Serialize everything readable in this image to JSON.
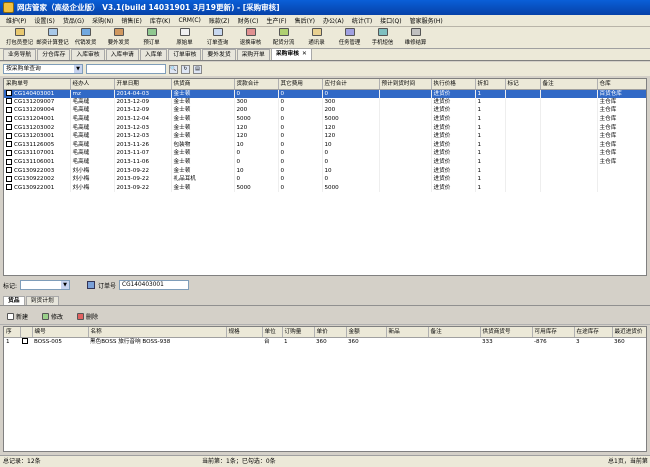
{
  "window": {
    "title": "网店管家（高级企业版） V3.1(build 14031901 3月19更新) - [采购审核]"
  },
  "menu": [
    "维护(P)",
    "设置(S)",
    "货品(G)",
    "采购(N)",
    "销售(E)",
    "库存(K)",
    "CRM(C)",
    "账款(Z)",
    "财务(C)",
    "生产(F)",
    "售后(Y)",
    "办公(A)",
    "统计(T)",
    "接口(Q)",
    "管家服务(H)"
  ],
  "toolbar": [
    {
      "label": "打包员登记",
      "icon": "package-icon"
    },
    {
      "label": "邮资计算登记",
      "icon": "calculator-icon"
    },
    {
      "label": "代销发货",
      "icon": "truck-icon"
    },
    {
      "label": "要外发货",
      "icon": "box-icon"
    },
    {
      "label": "预订单",
      "icon": "clipboard-icon"
    },
    {
      "label": "原始单",
      "icon": "document-icon"
    },
    {
      "label": "订单查询",
      "icon": "search-icon"
    },
    {
      "label": "退换审核",
      "icon": "return-icon"
    },
    {
      "label": "配货分流",
      "icon": "split-icon"
    },
    {
      "label": "通讯录",
      "icon": "contacts-icon"
    },
    {
      "label": "任务管理",
      "icon": "task-icon"
    },
    {
      "label": "手机短信",
      "icon": "phone-icon"
    },
    {
      "label": "维修结算",
      "icon": "wrench-icon"
    }
  ],
  "tabs": [
    {
      "label": "业务导航",
      "active": false
    },
    {
      "label": "分仓库存",
      "active": false
    },
    {
      "label": "入库审核",
      "active": false
    },
    {
      "label": "入库申请",
      "active": false
    },
    {
      "label": "入库单",
      "active": false
    },
    {
      "label": "订单审核",
      "active": false
    },
    {
      "label": "要外发货",
      "active": false
    },
    {
      "label": "采购开单",
      "active": false
    },
    {
      "label": "采购审核",
      "active": true
    }
  ],
  "query": {
    "mode": "按采购单查询",
    "value": ""
  },
  "purchase_table": {
    "columns": [
      "采购单号",
      "经办人",
      "开单日期",
      "供货商",
      "货款合计",
      "其它费用",
      "应付合计",
      "预计到货时间",
      "执行价格",
      "折扣",
      "标记",
      "备注",
      "仓库"
    ],
    "rows": [
      [
        "CG140403001",
        "mz",
        "2014-04-03",
        "金士顿",
        "0",
        "0",
        "0",
        "",
        "进货价",
        "1",
        "",
        "",
        "百货仓库"
      ],
      [
        "CG131209007",
        "毛高缝",
        "2013-12-09",
        "金士顿",
        "300",
        "0",
        "300",
        "",
        "进货价",
        "1",
        "",
        "",
        "主仓库"
      ],
      [
        "CG131209004",
        "毛高缝",
        "2013-12-09",
        "金士顿",
        "200",
        "0",
        "200",
        "",
        "进货价",
        "1",
        "",
        "",
        "主仓库"
      ],
      [
        "CG131204001",
        "毛高缝",
        "2013-12-04",
        "金士顿",
        "5000",
        "0",
        "5000",
        "",
        "进货价",
        "1",
        "",
        "",
        "主仓库"
      ],
      [
        "CG131203002",
        "毛高缝",
        "2013-12-03",
        "金士顿",
        "120",
        "0",
        "120",
        "",
        "进货价",
        "1",
        "",
        "",
        "主仓库"
      ],
      [
        "CG131203001",
        "毛高缝",
        "2013-12-03",
        "金士顿",
        "120",
        "0",
        "120",
        "",
        "进货价",
        "1",
        "",
        "",
        "主仓库"
      ],
      [
        "CG131126005",
        "毛高缝",
        "2013-11-26",
        "包装物",
        "10",
        "0",
        "10",
        "",
        "进货价",
        "1",
        "",
        "",
        "主仓库"
      ],
      [
        "CG131107001",
        "毛高缝",
        "2013-11-07",
        "金士顿",
        "0",
        "0",
        "0",
        "",
        "进货价",
        "1",
        "",
        "",
        "主仓库"
      ],
      [
        "CG131106001",
        "毛高缝",
        "2013-11-06",
        "金士顿",
        "0",
        "0",
        "0",
        "",
        "进货价",
        "1",
        "",
        "",
        "主仓库"
      ],
      [
        "CG130922003",
        "刘小梅",
        "2013-09-22",
        "金士顿",
        "10",
        "0",
        "10",
        "",
        "进货价",
        "1",
        "",
        "",
        ""
      ],
      [
        "CG130922002",
        "刘小梅",
        "2013-09-22",
        "礼品耳机",
        "0",
        "0",
        "0",
        "",
        "进货价",
        "1",
        "",
        "",
        ""
      ],
      [
        "CG130922001",
        "刘小梅",
        "2013-09-22",
        "金士顿",
        "5000",
        "0",
        "5000",
        "",
        "进货价",
        "1",
        "",
        "",
        ""
      ]
    ]
  },
  "mid": {
    "mark_label": "标记:",
    "order_label": "订单号",
    "order_no": "CG140403001"
  },
  "detail_tabs": [
    {
      "label": "货品",
      "active": true
    },
    {
      "label": "到货计划",
      "active": false
    }
  ],
  "actions": [
    "新建",
    "修改",
    "删除"
  ],
  "goods_table": {
    "columns": [
      "序",
      "",
      "编号",
      "名称",
      "规格",
      "单位",
      "订购量",
      "单价",
      "金额",
      "新品",
      "备注",
      "供货商货号",
      "可用库存",
      "在途库存",
      "最近进货价"
    ],
    "rows": [
      [
        "1",
        "",
        "BOSS-005",
        "黑色BOSS 旅行音响 BOSS-938",
        "",
        "台",
        "1",
        "360",
        "360",
        "",
        "",
        "333",
        "-876",
        "3",
        "360"
      ]
    ]
  },
  "status": {
    "total": "总记录：12条",
    "current": "当前第：1条；已勾选：0条",
    "page": "总1页，当前第"
  }
}
